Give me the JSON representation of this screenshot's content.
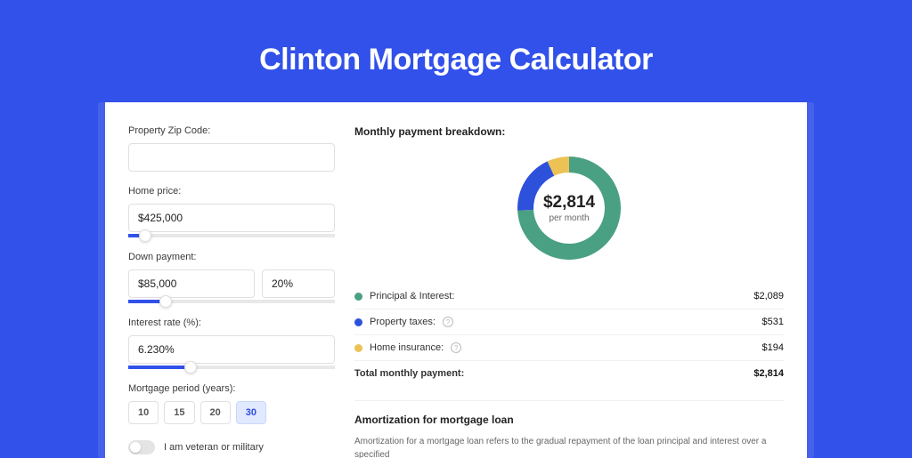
{
  "page_title": "Clinton Mortgage Calculator",
  "form": {
    "zip": {
      "label": "Property Zip Code:",
      "value": ""
    },
    "home_price": {
      "label": "Home price:",
      "value": "$425,000",
      "slider_pct": 8
    },
    "down_payment": {
      "label": "Down payment:",
      "value": "$85,000",
      "pct_value": "20%",
      "slider_pct": 18
    },
    "interest_rate": {
      "label": "Interest rate (%):",
      "value": "6.230%",
      "slider_pct": 30
    },
    "period": {
      "label": "Mortgage period (years):",
      "options": [
        "10",
        "15",
        "20",
        "30"
      ],
      "active": "30"
    },
    "veteran": {
      "label": "I am veteran or military",
      "checked": false
    }
  },
  "breakdown": {
    "title": "Monthly payment breakdown:",
    "amount": "$2,814",
    "sub": "per month",
    "items": [
      {
        "label": "Principal & Interest:",
        "value": "$2,089",
        "color": "green"
      },
      {
        "label": "Property taxes:",
        "value": "$531",
        "color": "blue",
        "info": true
      },
      {
        "label": "Home insurance:",
        "value": "$194",
        "color": "yellow",
        "info": true
      }
    ],
    "total_label": "Total monthly payment:",
    "total_value": "$2,814"
  },
  "amortization": {
    "title": "Amortization for mortgage loan",
    "text": "Amortization for a mortgage loan refers to the gradual repayment of the loan principal and interest over a specified"
  },
  "chart_data": {
    "type": "pie",
    "title": "Monthly payment breakdown",
    "series": [
      {
        "name": "Principal & Interest",
        "value": 2089,
        "color": "#4aa082"
      },
      {
        "name": "Property taxes",
        "value": 531,
        "color": "#2d51db"
      },
      {
        "name": "Home insurance",
        "value": 194,
        "color": "#ecc255"
      }
    ],
    "total": 2814,
    "center_label": "$2,814 per month"
  }
}
